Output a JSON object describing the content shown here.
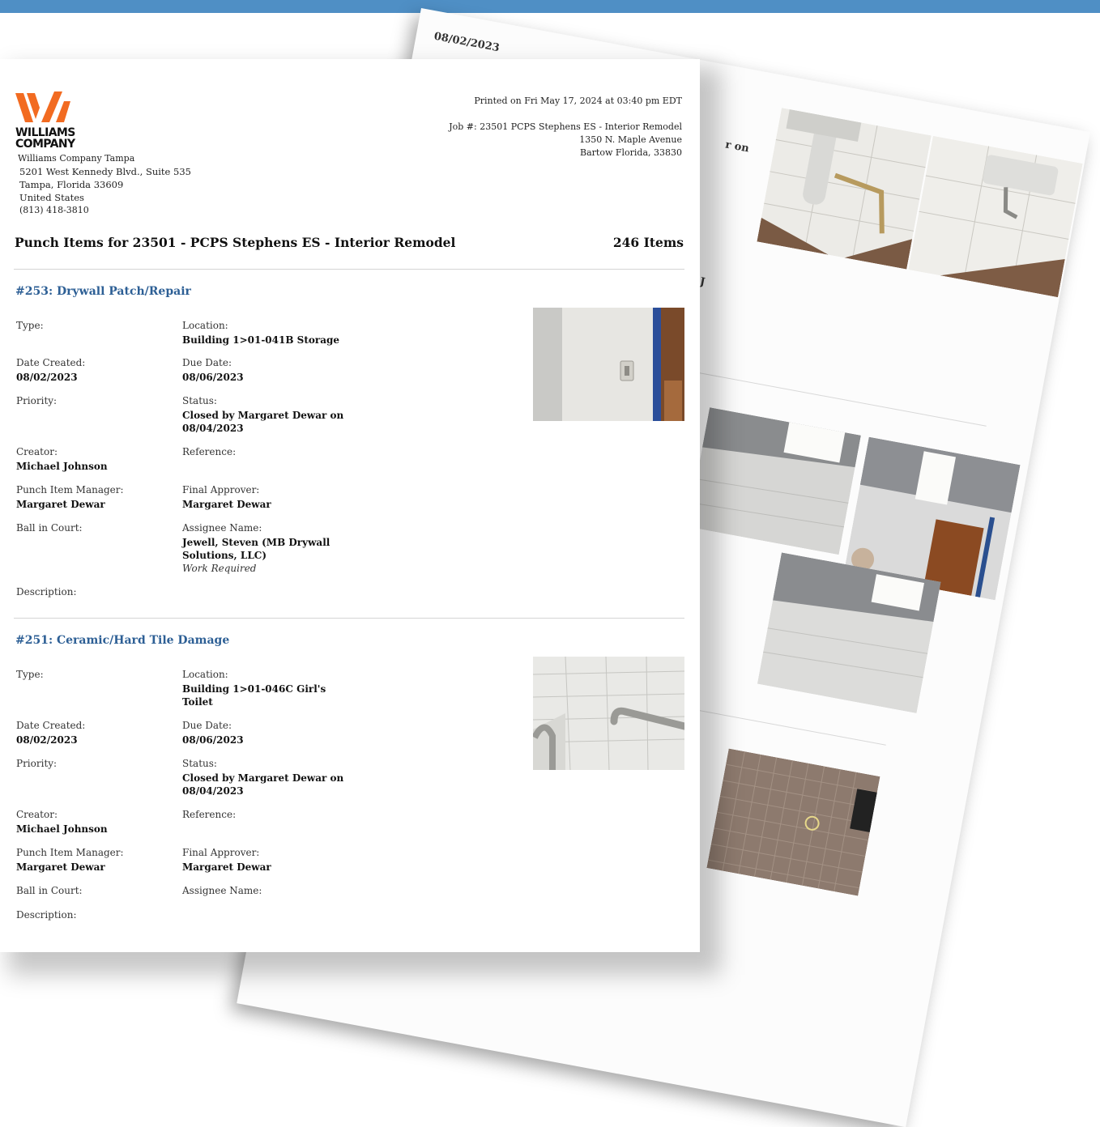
{
  "back_page": {
    "date": "08/02/2023",
    "frag_on": "r on",
    "frag_j": "J"
  },
  "company": {
    "logo_line1": "WILLIAMS",
    "logo_line2": "COMPANY",
    "brand_color": "#f26b21",
    "name": "Williams Company Tampa",
    "street": "5201 West Kennedy Blvd., Suite 535",
    "city": "Tampa, Florida 33609",
    "country": "United States",
    "phone": "(813) 418-3810"
  },
  "print_info": {
    "printed_on": "Printed on Fri May 17, 2024 at 03:40 pm EDT",
    "job": "Job #: 23501 PCPS Stephens ES - Interior Remodel",
    "street": "1350 N. Maple Avenue",
    "city": "Bartow Florida, 33830"
  },
  "report": {
    "title": "Punch Items for 23501 - PCPS Stephens ES - Interior Remodel",
    "count": "246 Items"
  },
  "labels": {
    "type": "Type:",
    "location": "Location:",
    "date_created": "Date Created:",
    "due_date": "Due Date:",
    "priority": "Priority:",
    "status": "Status:",
    "creator": "Creator:",
    "reference": "Reference:",
    "manager": "Punch Item Manager:",
    "approver": "Final Approver:",
    "ball": "Ball in Court:",
    "assignee": "Assignee Name:",
    "description": "Description:"
  },
  "items": [
    {
      "heading": "#253: Drywall Patch/Repair",
      "location": "Building 1>01-041B Storage",
      "date_created": "08/02/2023",
      "due_date": "08/06/2023",
      "status_l1": "Closed by Margaret Dewar on",
      "status_l2": "08/04/2023",
      "creator": "Michael Johnson",
      "manager": "Margaret Dewar",
      "approver": "Margaret Dewar",
      "assignee_l1": "Jewell, Steven (MB Drywall",
      "assignee_l2": "Solutions, LLC)",
      "assignee_note": "Work Required"
    },
    {
      "heading": "#251: Ceramic/Hard Tile Damage",
      "location_l1": "Building 1>01-046C Girl's",
      "location_l2": "Toilet",
      "date_created": "08/02/2023",
      "due_date": "08/06/2023",
      "status_l1": "Closed by Margaret Dewar on",
      "status_l2": "08/04/2023",
      "creator": "Michael Johnson",
      "manager": "Margaret Dewar",
      "approver": "Margaret Dewar"
    }
  ]
}
